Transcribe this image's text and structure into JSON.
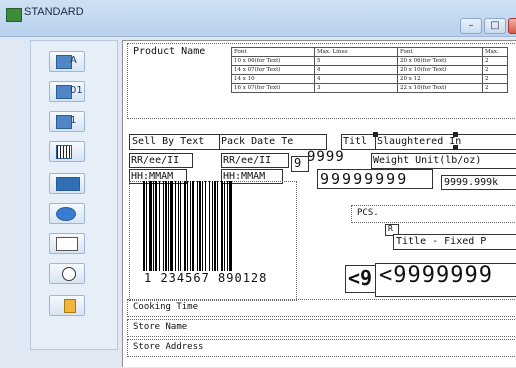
{
  "window": {
    "title": "STANDARD",
    "min_glyph": "–",
    "max_glyph": "□",
    "close_glyph": "x"
  },
  "sidebar": {
    "tools": [
      {
        "label": "A",
        "icon": "text-tool-icon"
      },
      {
        "label": "01",
        "icon": "counter-tool-icon"
      },
      {
        "label": "1",
        "icon": "number-tool-icon"
      },
      {
        "label": "",
        "icon": "barcode-tool-icon"
      },
      {
        "label": "",
        "icon": "image-tool-icon"
      },
      {
        "label": "",
        "icon": "logo-tool-icon"
      },
      {
        "label": "",
        "icon": "box-tool-icon"
      },
      {
        "label": "",
        "icon": "clock-tool-icon"
      },
      {
        "label": "",
        "icon": "person-tool-icon"
      }
    ]
  },
  "label": {
    "product_name": "Product Name",
    "font_table": {
      "headers": [
        "Font",
        "Max. Lines",
        "Font",
        "Max."
      ],
      "rows": [
        [
          "10 x 06(for Text)",
          "5",
          "20 x 06(for Text)",
          "2"
        ],
        [
          "14 x 07(for Text)",
          "4",
          "20 x 10(for Text)",
          "2"
        ],
        [
          "14 x 10",
          "4",
          "20 x 12",
          "2"
        ],
        [
          "16 x 07(for Text)",
          "3",
          "22 x 10(for Text)",
          "2"
        ]
      ]
    },
    "sell_by_text": "Sell By Text",
    "pack_date_text": "Pack Date Te",
    "title_short": "Titl",
    "slaughtered_in": "Slaughtered In",
    "date1": "RR/ee/II",
    "date2": "RR/ee/II",
    "time1": "HH:MMAM",
    "time2": "HH:MMAM",
    "nine_small": "9",
    "nines1": "9999",
    "weight_unit": "Weight Unit(lb/oz)",
    "nines2": "99999999",
    "weight_value": "9999.999k",
    "pcs": "PCS.",
    "r_box": "R",
    "title_fixed": "Title - Fixed P",
    "lt_small": "<9",
    "lt_big": "<9999999",
    "barcode_digits": "1 234567 890128",
    "cooking_time": "Cooking Time",
    "store_name": "Store Name",
    "store_address": "Store Address"
  }
}
